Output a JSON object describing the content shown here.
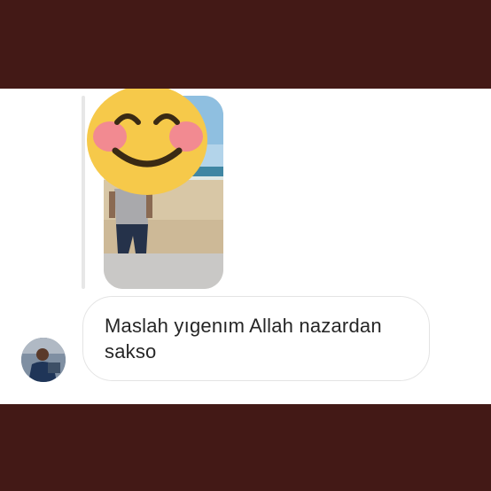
{
  "message": {
    "text": "Maslah yıgenım Allah nazardan sakso"
  },
  "icons": {
    "sticker": "smiling-face-with-blush-emoji",
    "avatar": "user-avatar"
  },
  "colors": {
    "frame_background": "#431916",
    "chat_background": "#ffffff",
    "bubble_border": "#e4e4e4",
    "text": "#262626",
    "reply_bar": "#e7e7e7"
  }
}
